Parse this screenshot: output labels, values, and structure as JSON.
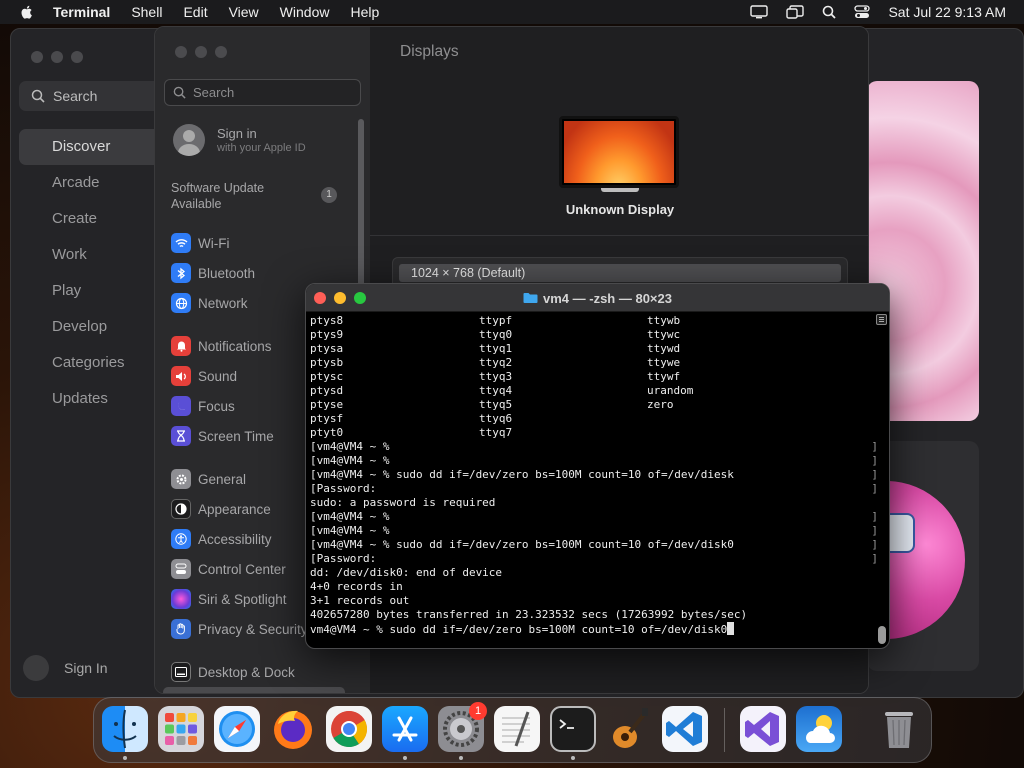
{
  "menubar": {
    "app": "Terminal",
    "items": [
      "Shell",
      "Edit",
      "View",
      "Window",
      "Help"
    ],
    "clock": "Sat Jul 22  9:13 AM"
  },
  "appstore": {
    "search_placeholder": "Search",
    "nav": [
      "Discover",
      "Arcade",
      "Create",
      "Work",
      "Play",
      "Develop",
      "Categories",
      "Updates"
    ],
    "sign_in": "Sign In"
  },
  "settings": {
    "search_placeholder": "Search",
    "user": {
      "title": "Sign in",
      "subtitle": "with your Apple ID"
    },
    "update": {
      "label": "Software Update Available",
      "badge": "1"
    },
    "items": [
      {
        "label": "Wi-Fi",
        "color": "#2f7cf6"
      },
      {
        "label": "Bluetooth",
        "color": "#2f7cf6"
      },
      {
        "label": "Network",
        "color": "#2f7cf6"
      },
      {
        "label": "Notifications",
        "color": "#e5403a"
      },
      {
        "label": "Sound",
        "color": "#e5403a"
      },
      {
        "label": "Focus",
        "color": "#5a4fd6"
      },
      {
        "label": "Screen Time",
        "color": "#5a4fd6"
      },
      {
        "label": "General",
        "color": "#8e8e93"
      },
      {
        "label": "Appearance",
        "color": "#1c1c1e"
      },
      {
        "label": "Accessibility",
        "color": "#2f7cf6"
      },
      {
        "label": "Control Center",
        "color": "#8e8e93"
      },
      {
        "label": "Siri & Spotlight",
        "color": "#b04fd6"
      },
      {
        "label": "Privacy & Security",
        "color": "#3a70d6"
      },
      {
        "label": "Desktop & Dock",
        "color": "#1c1c1e"
      }
    ],
    "content": {
      "title": "Displays",
      "display_name": "Unknown Display",
      "resolution": "1024 × 768 (Default)"
    }
  },
  "terminal": {
    "title": "vm4 — -zsh — 80×23",
    "devices": [
      [
        "ptys8",
        "ttypf",
        "ttywb"
      ],
      [
        "ptys9",
        "ttyq0",
        "ttywc"
      ],
      [
        "ptysa",
        "ttyq1",
        "ttywd"
      ],
      [
        "ptysb",
        "ttyq2",
        "ttywe"
      ],
      [
        "ptysc",
        "ttyq3",
        "ttywf"
      ],
      [
        "ptysd",
        "ttyq4",
        "urandom"
      ],
      [
        "ptyse",
        "ttyq5",
        "zero"
      ],
      [
        "ptysf",
        "ttyq6",
        ""
      ],
      [
        "ptyt0",
        "ttyq7",
        ""
      ]
    ],
    "lines": [
      {
        "text": "[vm4@VM4 ~ %",
        "bracket": true
      },
      {
        "text": "[vm4@VM4 ~ %",
        "bracket": true
      },
      {
        "text": "[vm4@VM4 ~ % sudo dd if=/dev/zero bs=100M count=10 of=/dev/diesk",
        "bracket": true
      },
      {
        "text": "[Password:",
        "bracket": true
      },
      {
        "text": "sudo: a password is required",
        "bracket": false
      },
      {
        "text": "[vm4@VM4 ~ %",
        "bracket": true
      },
      {
        "text": "[vm4@VM4 ~ %",
        "bracket": true
      },
      {
        "text": "[vm4@VM4 ~ % sudo dd if=/dev/zero bs=100M count=10 of=/dev/disk0",
        "bracket": true
      },
      {
        "text": "[Password:",
        "bracket": true
      },
      {
        "text": "dd: /dev/disk0: end of device",
        "bracket": false
      },
      {
        "text": "4+0 records in",
        "bracket": false
      },
      {
        "text": "3+1 records out",
        "bracket": false
      },
      {
        "text": "402657280 bytes transferred in 23.323532 secs (17263992 bytes/sec)",
        "bracket": false
      }
    ],
    "current_command": "vm4@VM4 ~ % sudo dd if=/dev/zero bs=100M count=10 of=/dev/disk0"
  },
  "dock": {
    "settings_badge": "1",
    "apps": [
      {
        "name": "finder-icon",
        "bg": "#2a8cf0"
      },
      {
        "name": "launchpad-icon",
        "bg": "#d8d8dc"
      },
      {
        "name": "safari-icon",
        "bg": "#eef4fb"
      },
      {
        "name": "firefox-icon",
        "bg": "#3a1d6e"
      },
      {
        "name": "chrome-icon",
        "bg": "#f2f2f2"
      },
      {
        "name": "app-store-icon",
        "bg": "#1e8ef5"
      },
      {
        "name": "system-settings-icon",
        "bg": "#8d8d92"
      },
      {
        "name": "textedit-icon",
        "bg": "#f4f4f4"
      },
      {
        "name": "terminal-icon",
        "bg": "#1c1c1c"
      },
      {
        "name": "garageband-icon",
        "bg": "#2b2b2e"
      },
      {
        "name": "vscode-icon",
        "bg": "#f3f6fb"
      },
      {
        "name": "visual-studio-icon",
        "bg": "#f4f2fb"
      },
      {
        "name": "weather-icon",
        "bg": "#2f86e6"
      },
      {
        "name": "trash-icon",
        "bg": "transparent"
      }
    ]
  }
}
